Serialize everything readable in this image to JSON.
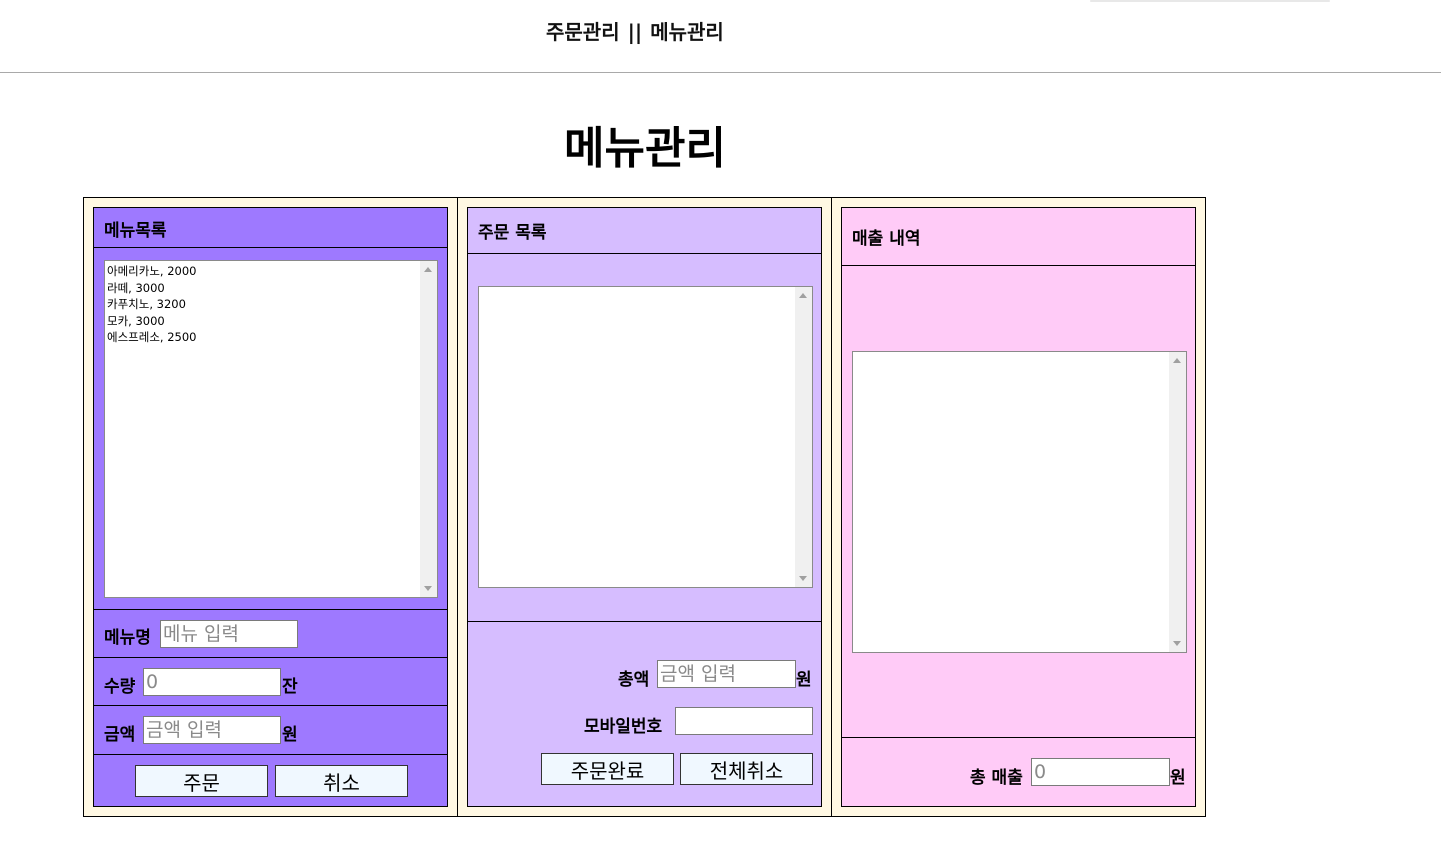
{
  "nav": {
    "order_link": "주문관리",
    "separator": "||",
    "menu_link": "메뉴관리"
  },
  "page_title": "메뉴관리",
  "menu_panel": {
    "title": "메뉴목록",
    "items": [
      "아메리카노, 2000",
      "라떼, 3000",
      "카푸치노, 3200",
      "모카, 3000",
      "에스프레소, 2500"
    ],
    "menu_name_label": "메뉴명",
    "menu_name_placeholder": "메뉴 입력",
    "qty_label": "수량",
    "qty_placeholder": "0",
    "qty_unit": "잔",
    "price_label": "금액",
    "price_placeholder": "금액 입력",
    "price_unit": "원",
    "order_button": "주문",
    "cancel_button": "취소"
  },
  "order_panel": {
    "title": "주문 목록",
    "total_label": "총액",
    "total_placeholder": "금액 입력",
    "total_unit": "원",
    "mobile_label": "모바일번호",
    "mobile_value": "",
    "complete_button": "주문완료",
    "cancel_all_button": "전체취소"
  },
  "sales_panel": {
    "title": "매출 내역",
    "total_sales_label": "총 매출",
    "total_sales_placeholder": "0",
    "total_sales_unit": "원"
  },
  "colors": {
    "menu_panel_bg": "#9e79ff",
    "order_panel_bg": "#d6bdff",
    "sales_panel_bg": "#ffcbf7",
    "frame_bg": "#fff8e3",
    "button_bg": "#f0f8ff"
  }
}
